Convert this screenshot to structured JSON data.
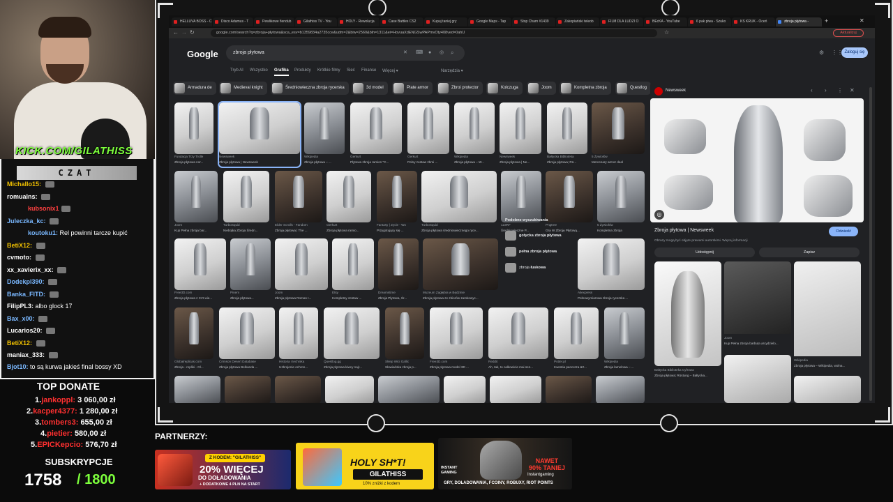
{
  "stream": {
    "kick_url": "KICK.COM/GILATHISS",
    "chat_title": "CZAT",
    "chat": [
      {
        "user": "Michallo15:",
        "text": "",
        "color": "#f0c000"
      },
      {
        "user": "romualns:",
        "text": "",
        "color": "#ffffff"
      },
      {
        "user": "kubsonix1",
        "text": "",
        "color": "#ff4040"
      },
      {
        "user": "Juleczka_kc:",
        "text": "",
        "color": "#7ab8ff"
      },
      {
        "user": "koutoku1:",
        "text": "Rel powinni tarcze kupić",
        "color": "#7ab8ff"
      },
      {
        "user": "BetiX12:",
        "text": "",
        "color": "#f0c000"
      },
      {
        "user": "cvmoto:",
        "text": "",
        "color": "#ffffff"
      },
      {
        "user": "xx_xavierix_xx:",
        "text": "",
        "color": "#ffffff"
      },
      {
        "user": "Dodekpl390:",
        "text": "",
        "color": "#7ab8ff"
      },
      {
        "user": "Banka_FITD:",
        "text": "",
        "color": "#7ab8ff"
      },
      {
        "user": "FilipPL3:",
        "text": "albo glock 17",
        "color": "#ffffff"
      },
      {
        "user": "Bax_x00:",
        "text": "",
        "color": "#7ab8ff"
      },
      {
        "user": "Lucarios20:",
        "text": "",
        "color": "#ffffff"
      },
      {
        "user": "BetiX12:",
        "text": "",
        "color": "#f0c000"
      },
      {
        "user": "maniax_333:",
        "text": "",
        "color": "#ffffff"
      },
      {
        "user": "Bjot10:",
        "text": "to są kurwa jakieś final bossy XD",
        "color": "#7ab8ff"
      }
    ],
    "top_donate_title": "TOP DONATE",
    "donations": [
      {
        "rank": "1.",
        "name": "jankoppl:",
        "amount": "3 060,00 zł"
      },
      {
        "rank": "2.",
        "name": "kacper4377:",
        "amount": "1 280,00 zł"
      },
      {
        "rank": "3.",
        "name": "tombers3:",
        "amount": "655,00 zł"
      },
      {
        "rank": "4.",
        "name": "pietier:",
        "amount": "580,00 zł"
      },
      {
        "rank": "5.",
        "name": "EPICKepcio:",
        "amount": "576,70 zł"
      }
    ],
    "subs_title": "SUBSKRYPCJE",
    "subs_count": "1758",
    "subs_goal": "/ 1800",
    "partners_label": "PARTNERZY:",
    "ad_casedrop": {
      "code": "Z KODEM: \"GILATHISS\"",
      "line1": "20% WIĘCEJ",
      "line2": "DO DOŁADOWANIA",
      "line3": "+ DODATKOWE 4 PLN NA START"
    },
    "ad_holy": {
      "title": "HOLY SH*T!",
      "code": "GILATHISS",
      "sub": "10% zniżki z kodem"
    },
    "ad_instant": {
      "top": "NAWET",
      "pct": "90% TANIEJ",
      "brand": "Instantgaming",
      "footer": "GRY, DOŁADOWANIA, FCOINY, ROBUXY, RIOT POINTS",
      "logo": "INSTANT GAMING"
    }
  },
  "browser": {
    "tabs": [
      "HELLUVA BOSS - C",
      "Disco Adamus - T",
      "Pewlikowe fiendub",
      "Gilathiss TV - You",
      "HOLY - Rewolucja",
      "Case Battles CS2",
      "Kupuj taniej gry",
      "Google Maps - Tap",
      "Stop Charn #1439",
      "Zakopiański teleob",
      "FILM DLA LUDZI O",
      "BEcKA - YouTube",
      "6 pak piwa - Szuko",
      "KS KRUK - Oceń",
      "zbroja płytowa -"
    ],
    "url": "google.com/search?q=zbroja+płytowa&sca_esv=b1359834a2735cce&udm=2&biw=2560&bih=1311&ei=HovuaXdENGSwPAPmvOty408ved=0ahU",
    "update_label": "Aktualizuj"
  },
  "google": {
    "logo": "Google",
    "query": "zbroja płytowa",
    "signin": "Zaloguj się",
    "tabs": [
      "Tryb AI",
      "Wszystko",
      "Grafika",
      "Produkty",
      "Krótkie filmy",
      "Sieć",
      "Finanse",
      "Więcej ▾"
    ],
    "tools": "Narzędzia ▾",
    "chips": [
      "Armadura de",
      "Medieval knight",
      "Średniowieczna zbroja rycerska",
      "3d model",
      "Plate armor",
      "Zbroi protector",
      "Kolczuga",
      "Joom",
      "Kompletna zbroja",
      "Questlog"
    ],
    "results": [
      {
        "src": "Fundacja Trzy Trolle",
        "title": "Zbroja płytowa nor..."
      },
      {
        "src": "Newsweek",
        "title": "Zbroja płytowa | Newsweek"
      },
      {
        "src": "Wikipedia",
        "title": "Zbroja płytowa – ..."
      },
      {
        "src": "Gerkurt",
        "title": "Płytowa zbroja ramion \"C..."
      },
      {
        "src": "Gerkurt",
        "title": "Pełny zestaw zbroi ..."
      },
      {
        "src": "Wikipedia",
        "title": "Zbroja płytowa – W..."
      },
      {
        "src": "Newsweek",
        "title": "Zbroja płytowa | Ne..."
      },
      {
        "src": "Bałtycka Biblioteka",
        "title": "Zbroja płytowa; Rü..."
      },
      {
        "src": "5 Żywiołów",
        "title": "Mercenary armor deal"
      },
      {
        "src": "Joom",
        "title": "Kup Pełna zbroja bar..."
      },
      {
        "src": "TurboSquid",
        "title": "Niebojka Zbroja Średn..."
      },
      {
        "src": "Elder Scrolls - Fandom",
        "title": "Zbroja płytowa | The ..."
      },
      {
        "src": "Gerkurt",
        "title": "Zbroja płytowa ramio..."
      },
      {
        "src": "Fantasy | Zycie - Wo",
        "title": "Przygotujący się ..."
      },
      {
        "src": "TurboSquid",
        "title": "Zbroja płytowa średniowiecznego ryce..."
      },
      {
        "src": "123RF",
        "title": "Średniowieczne P..."
      },
      {
        "src": "Pngtree",
        "title": "Gra W Zbroję Płytową..."
      },
      {
        "src": "5 Żywiołów",
        "title": "Kompletna zbroja"
      },
      {
        "src": "Free3D.com",
        "title": "Zbroja płytowa z XVI wie..."
      },
      {
        "src": "Pinem",
        "title": "Zbroja płytowa..."
      },
      {
        "src": "Joom",
        "title": "Zbroja płytowa Roman I..."
      },
      {
        "src": "Etsy",
        "title": "Kompletny zestaw ..."
      },
      {
        "src": "Dreamstime",
        "title": "Zbroja Płytowa, Śr..."
      },
      {
        "src": "Muzeum Zagłębia w Będzinie",
        "title": "Zbroja płytowa ze zbiorów zamkowyc..."
      },
      {
        "src": "Aliexpress",
        "title": "Pełnowymiarowa zbroja rycerska ..."
      },
      {
        "src": "Globalreplicas.com",
        "title": "Zbroja - repliki - Gl..."
      },
      {
        "src": "Crimson Desert Database",
        "title": "Zbroja płytowa Belkanda ..."
      },
      {
        "src": "Historia i technika",
        "title": "Uzbrojenie ochron..."
      },
      {
        "src": "Questlog.gg",
        "title": "Zbroja płytowa kiwcy najr..."
      },
      {
        "src": "Sklep Wici Gallic",
        "title": "Słowiańska zbroja p..."
      },
      {
        "src": "Free3D.com",
        "title": "Zbroja płytowa model 3D ..."
      },
      {
        "src": "Reddit",
        "title": "Ah, tak, to całkowicie mai sen..."
      },
      {
        "src": "Potter.pl",
        "title": "Kwestia pancerza &#..."
      },
      {
        "src": "Wikipedia",
        "title": "Zbroja lamelowa – ..."
      }
    ],
    "related": {
      "title": "Podobne wyszukiwania",
      "items": [
        {
          "prefix": "",
          "bold": "gotycka zbroja płytowa"
        },
        {
          "prefix": "",
          "bold": "pełna zbroja płytowa"
        },
        {
          "prefix": "zbroja ",
          "bold": "łuskowa"
        }
      ]
    },
    "panel": {
      "source": "Newsweek",
      "title": "Zbroja płytowa | Newsweek",
      "note": "Obrazy mogą być objęte prawami autorskimi. Więcej informacji",
      "visit": "Odwiedź",
      "share": "Udostępnij",
      "save": "Zapisz",
      "related": [
        {
          "src": "Joom",
          "title": "Kup Pełna zbroja barbuta arcydzielo..."
        },
        {
          "src": "Bałtycka Biblioteka Cyfrowa",
          "title": "Zbroja płytowa; Rüstung – Bałtycka..."
        },
        {
          "src": "Wikipedia",
          "title": "Zbroja płytowa – Wikipedia, wolna..."
        }
      ]
    }
  }
}
